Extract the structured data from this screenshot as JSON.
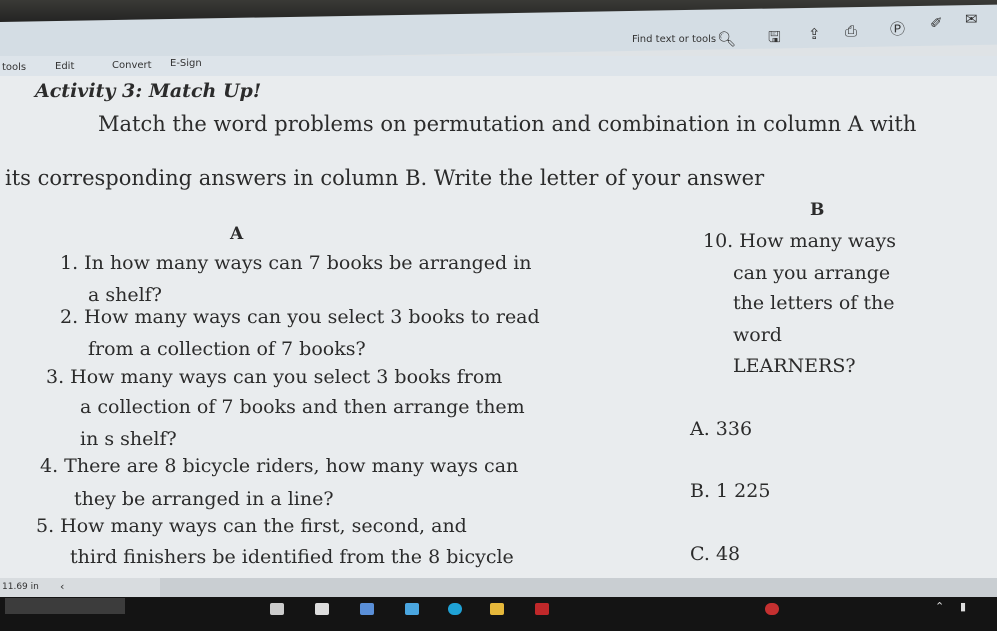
{
  "toolbar": {
    "search_label": "Find text or tools",
    "icons": [
      "search-icon",
      "save-icon",
      "upload-icon",
      "print-icon",
      "comment-icon",
      "link-icon",
      "mail-icon"
    ]
  },
  "menu": {
    "items": [
      "tools",
      "Edit",
      "Convert",
      "E-Sign"
    ]
  },
  "document": {
    "title": "Activity 3: Match Up!",
    "instructions": [
      "Match the word problems on permutation and combination in column A with",
      "its corresponding answers in column B. Write the letter of your answer"
    ],
    "column_a_header": "A",
    "column_b_header": "B",
    "column_a": [
      [
        "1.  In how many ways can 7 books be arranged in",
        "a shelf?"
      ],
      [
        "2.  How many ways can you select 3 books to read",
        "from a collection of 7 books?"
      ],
      [
        "3.  How many ways can you select 3 books from",
        "a collection of 7 books and then arrange them",
        "in s shelf?"
      ],
      [
        "4.  There are 8 bicycle riders, how many ways can",
        "they be arranged in a line?"
      ],
      [
        "5.  How many ways can the first, second, and",
        "third finishers be identified from the 8 bicycle"
      ]
    ],
    "column_b_question": [
      "10. How  many  ways",
      "can  you  arrange",
      "the  letters  of  the",
      "word",
      "LEARNERS?"
    ],
    "column_b_answers": [
      "A.  336",
      "B.  1 225",
      "C.  48"
    ]
  },
  "status": {
    "page_size": "11.69 in"
  }
}
